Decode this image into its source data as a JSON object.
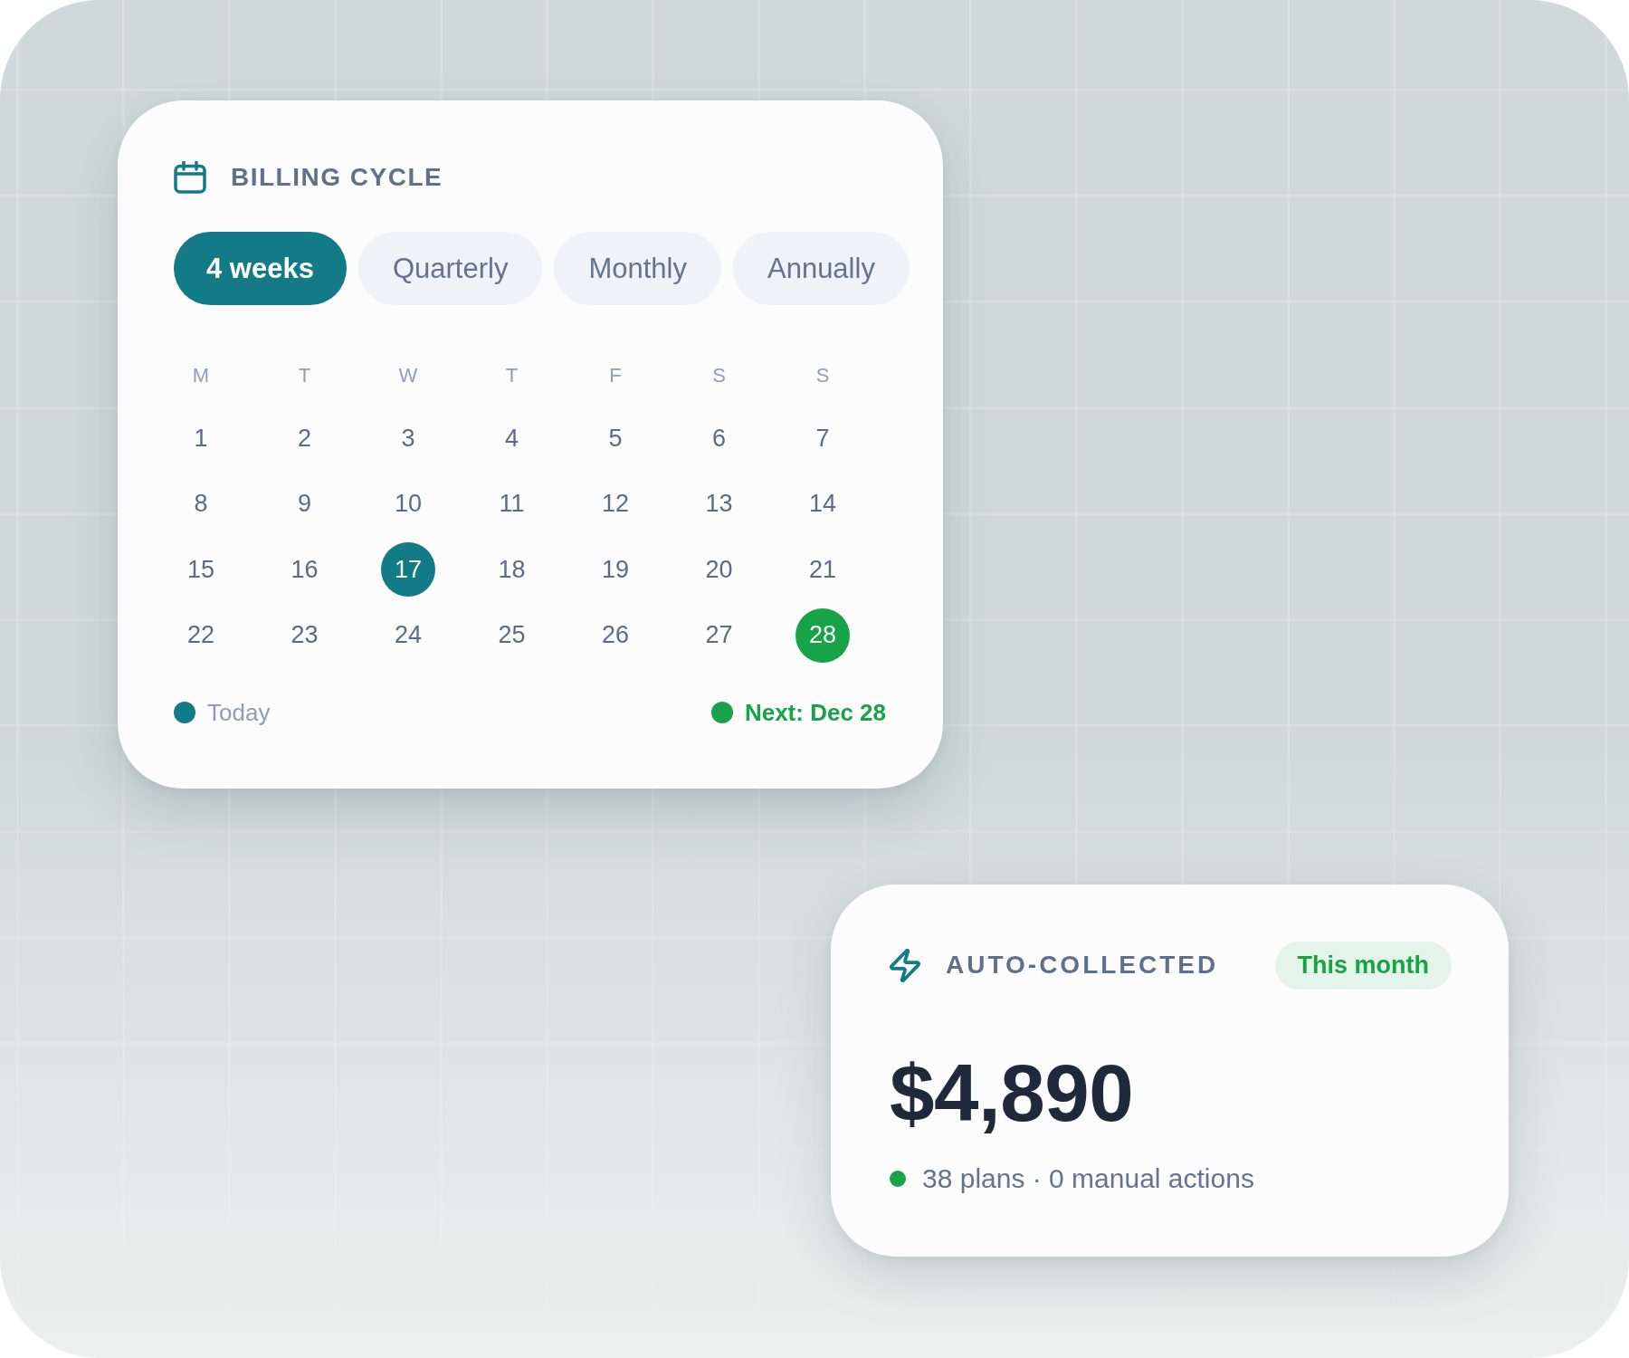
{
  "billing_cycle": {
    "title": "BILLING CYCLE",
    "tabs": [
      {
        "label": "4 weeks",
        "selected": true
      },
      {
        "label": "Quarterly",
        "selected": false
      },
      {
        "label": "Monthly",
        "selected": false
      },
      {
        "label": "Annually",
        "selected": false
      }
    ],
    "weekdays": [
      "M",
      "T",
      "W",
      "T",
      "F",
      "S",
      "S"
    ],
    "weeks": [
      [
        {
          "day": "1",
          "kind": "plain"
        },
        {
          "day": "2",
          "kind": "plain"
        },
        {
          "day": "3",
          "kind": "plain"
        },
        {
          "day": "4",
          "kind": "plain"
        },
        {
          "day": "5",
          "kind": "plain"
        },
        {
          "day": "6",
          "kind": "plain"
        },
        {
          "day": "7",
          "kind": "plain"
        }
      ],
      [
        {
          "day": "8",
          "kind": "plain"
        },
        {
          "day": "9",
          "kind": "plain"
        },
        {
          "day": "10",
          "kind": "plain"
        },
        {
          "day": "11",
          "kind": "plain"
        },
        {
          "day": "12",
          "kind": "plain"
        },
        {
          "day": "13",
          "kind": "plain"
        },
        {
          "day": "14",
          "kind": "plain"
        }
      ],
      [
        {
          "day": "15",
          "kind": "plain"
        },
        {
          "day": "16",
          "kind": "plain"
        },
        {
          "day": "17",
          "kind": "today"
        },
        {
          "day": "18",
          "kind": "plain"
        },
        {
          "day": "19",
          "kind": "plain"
        },
        {
          "day": "20",
          "kind": "plain"
        },
        {
          "day": "21",
          "kind": "plain"
        }
      ],
      [
        {
          "day": "22",
          "kind": "plain"
        },
        {
          "day": "23",
          "kind": "plain"
        },
        {
          "day": "24",
          "kind": "plain"
        },
        {
          "day": "25",
          "kind": "plain"
        },
        {
          "day": "26",
          "kind": "plain"
        },
        {
          "day": "27",
          "kind": "plain"
        },
        {
          "day": "28",
          "kind": "next"
        }
      ]
    ],
    "legend": [
      {
        "kind": "today",
        "label": "Today",
        "color": "#137a87"
      },
      {
        "kind": "next",
        "label": "Next: Dec 28",
        "color": "#18a349"
      }
    ]
  },
  "auto_collected": {
    "title": "AUTO-COLLECTED",
    "badge": "This month",
    "amount": "$4,890",
    "summary": "38 plans · 0 manual actions"
  }
}
